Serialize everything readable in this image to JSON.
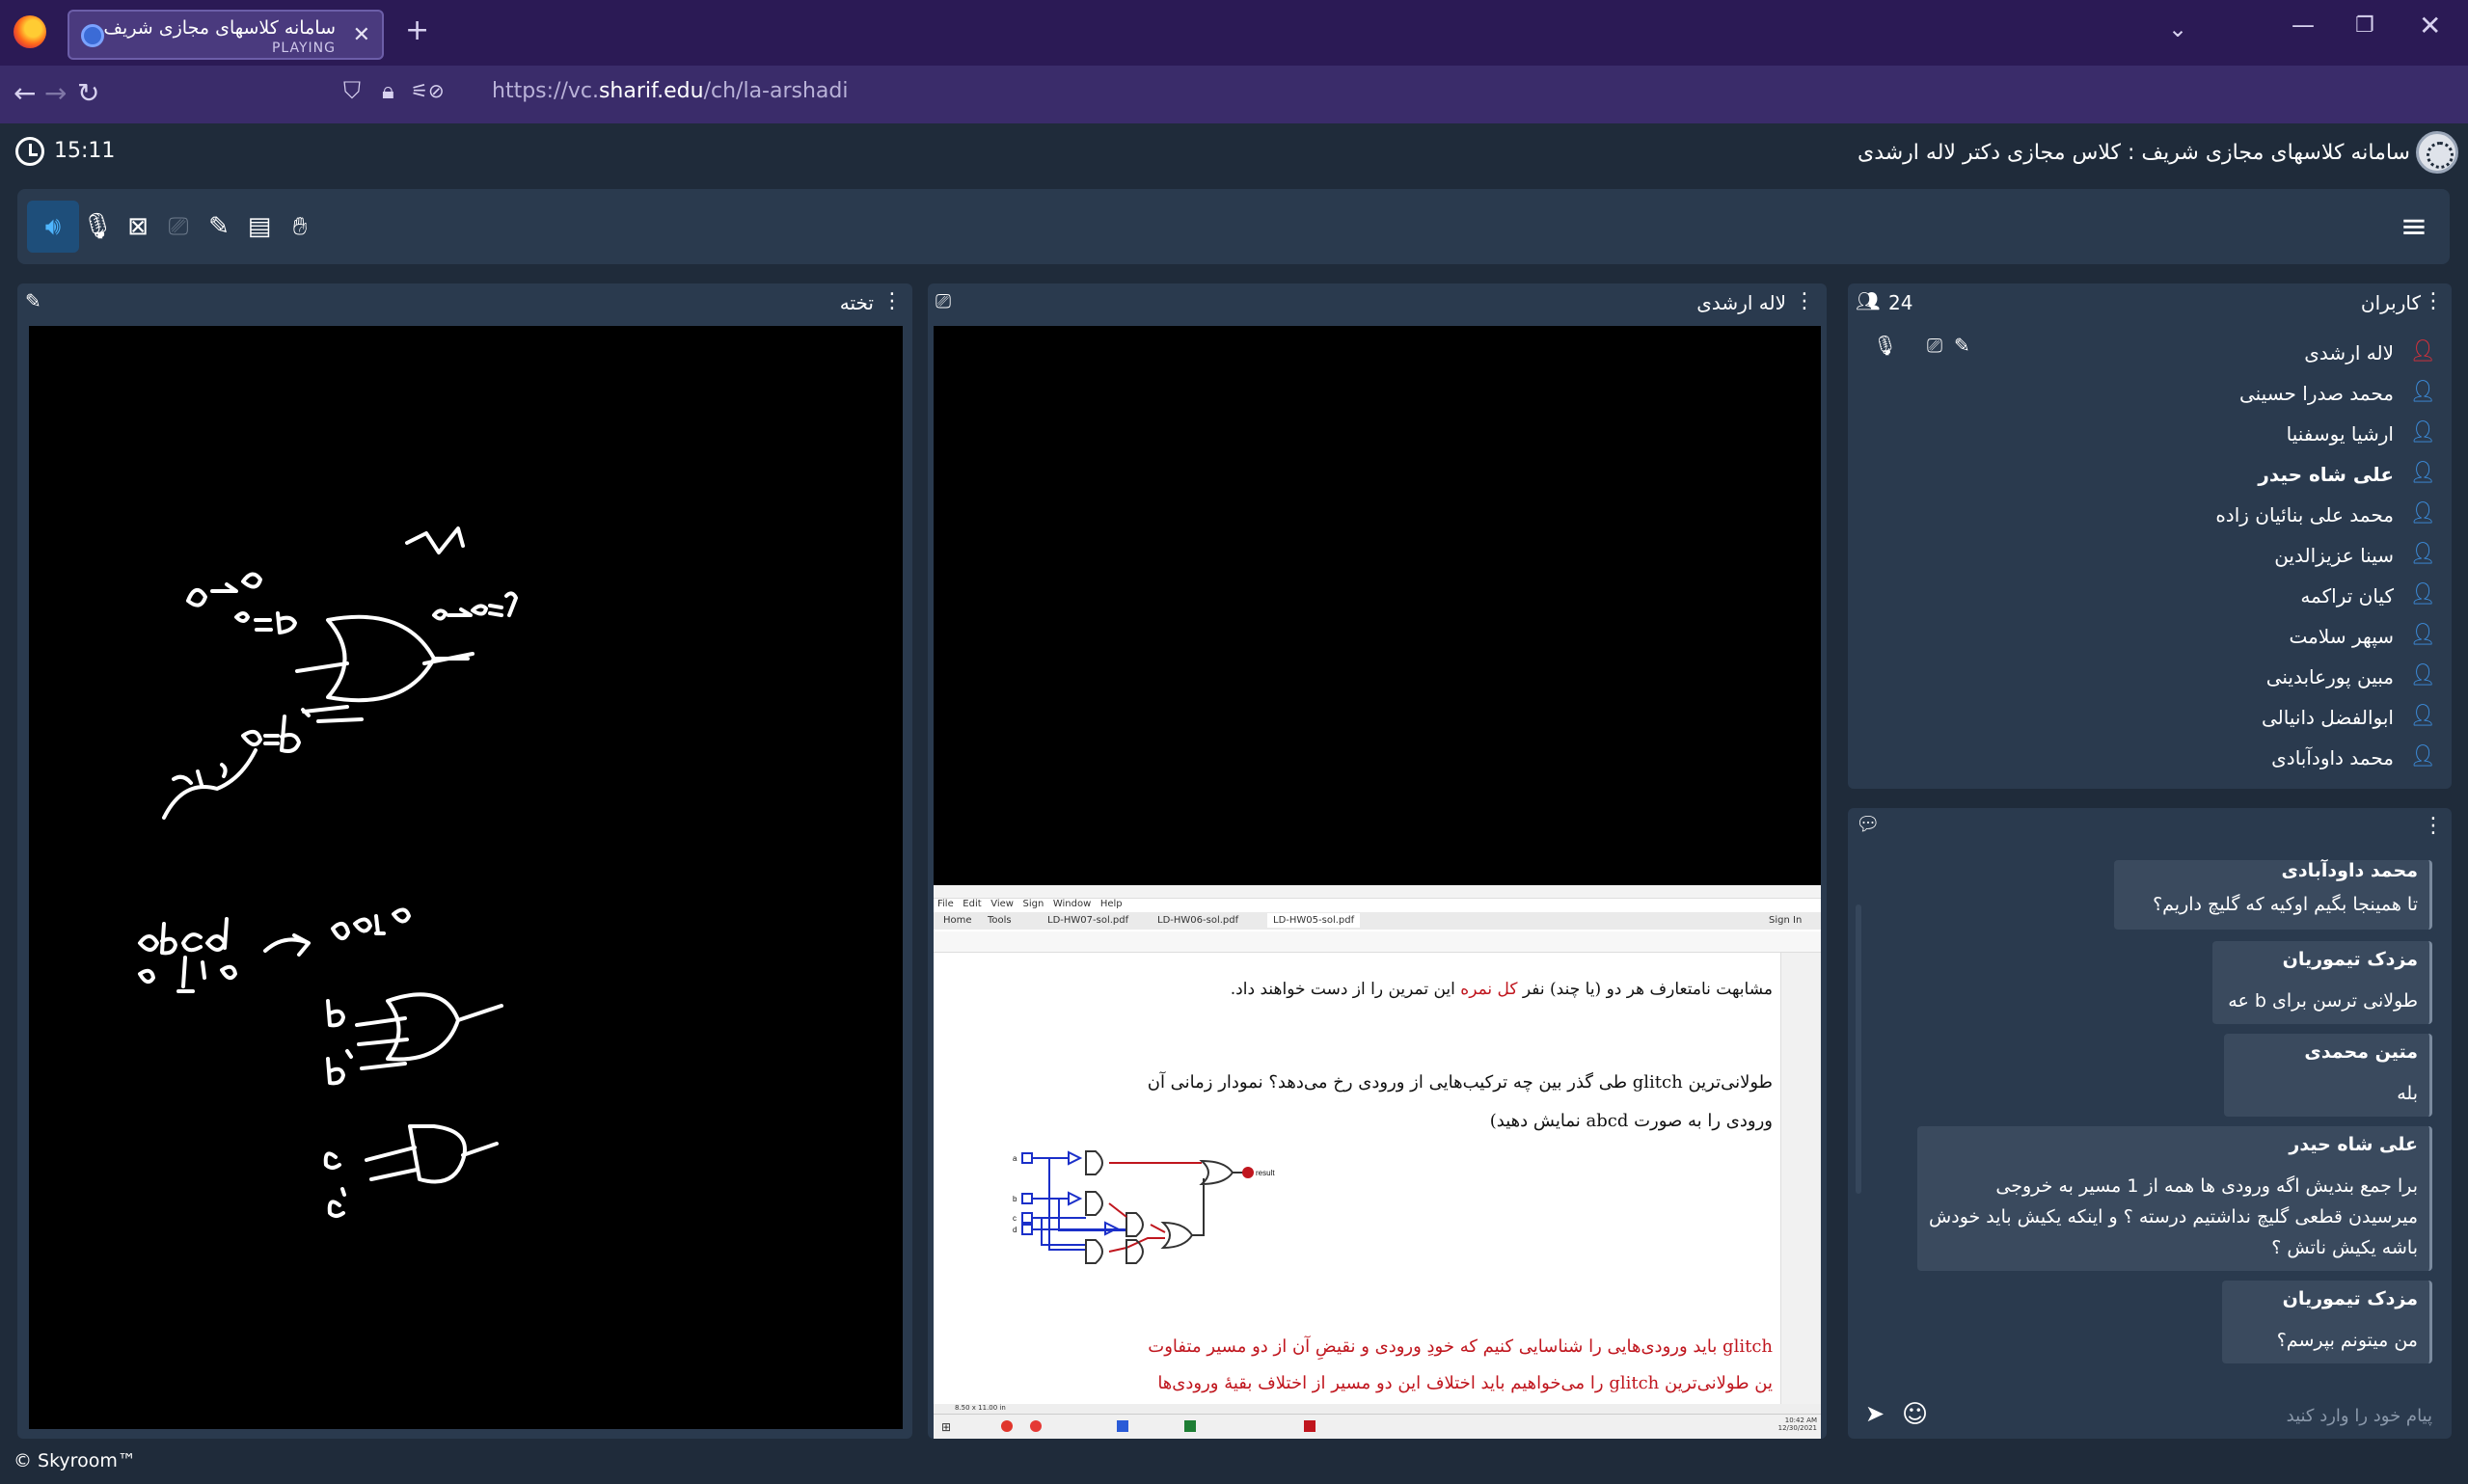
{
  "browser": {
    "tab_title": "سامانه کلاسهای مجازی شریف",
    "tab_status": "PLAYING",
    "url_prefix": "https://vc.",
    "url_domain": "sharif.edu",
    "url_path": "/ch/la-arshadi"
  },
  "app": {
    "time": "15:11",
    "title": "سامانه کلاسهای مجازی شریف : کلاس مجازی دکتر لاله ارشدی",
    "footer": "© Skyroom™"
  },
  "toolbar": {
    "buttons": [
      "speaker-icon",
      "mic-off-icon",
      "camera-off-icon",
      "share-screen-icon",
      "whiteboard-pen-icon",
      "files-icon",
      "raise-hand-icon",
      "menu-icon"
    ]
  },
  "whiteboard": {
    "title": "تخته",
    "handwriting": [
      "a→0",
      "a=b",
      "b→a→o",
      "0=b'",
      "abcd",
      "0 1 1 0",
      "0010",
      "b",
      "b'",
      "c",
      "c'",
      "طولانی تر"
    ]
  },
  "presenter": {
    "title": "لاله ارشدی",
    "shared_screen": {
      "menu": [
        "File",
        "Edit",
        "View",
        "Sign",
        "Window",
        "Help"
      ],
      "tabs": [
        "Home",
        "Tools",
        "LD-HW07-sol.pdf",
        "LD-HW06-sol.pdf",
        "LD-HW05-sol.pdf"
      ],
      "sign_in": "Sign In",
      "line1": "مشابهت نامتعارف هر دو (یا چند) نفر",
      "line1_red": "کل نمره",
      "line1_end": "این تمرین را از دست خواهند داد.",
      "question1": "طولانی‌ترین glitch طی گذر بین چه ترکیب‌هایی از ورودی رخ می‌دهد؟ نمودار زمانی آن",
      "question2": "ورودی را به صورت abcd نمایش دهید)",
      "answer1": "glitch باید ورودی‌هایی را شناسایی کنیم که خودِ ورودی و نقیضِ آن از دو مسیر متفاوت",
      "answer2": "ین طولانی‌ترین glitch را می‌خواهیم باید اختلاف این دو مسیر از اختلاف بقیهٔ ورودی‌ها",
      "circuit_inputs": [
        "a",
        "b",
        "c",
        "d"
      ],
      "circuit_output": "result",
      "taskbar_time": "10:42 AM",
      "taskbar_date": "12/30/2021",
      "page_size": "8.50 x 11.00 in"
    }
  },
  "users": {
    "title": "کاربران",
    "count": "24",
    "list": [
      {
        "name": "لاله ارشدی",
        "role": "host",
        "bold": false
      },
      {
        "name": "محمد صدرا حسینی",
        "role": "user",
        "bold": false
      },
      {
        "name": "ارشیا یوسفنیا",
        "role": "user",
        "bold": false
      },
      {
        "name": "علی شاه حیدر",
        "role": "user",
        "bold": true
      },
      {
        "name": "محمد علی بنائیان زاده",
        "role": "user",
        "bold": false
      },
      {
        "name": "سینا عزیزالدین",
        "role": "user",
        "bold": false
      },
      {
        "name": "کیان تراکمه",
        "role": "user",
        "bold": false
      },
      {
        "name": "سپهر سلامت",
        "role": "user",
        "bold": false
      },
      {
        "name": "مبین پورعابدینی",
        "role": "user",
        "bold": false
      },
      {
        "name": "ابوالفضل دانیالی",
        "role": "user",
        "bold": false
      },
      {
        "name": "محمد داودآبادی",
        "role": "user",
        "bold": false
      }
    ],
    "colors": {
      "host": "#e0303a",
      "user": "#3d8fe0"
    }
  },
  "chat": {
    "messages": [
      {
        "author": "محمد داودآبادی",
        "text": "تا همینجا بگیم اوکیه که گلیچ داریم؟"
      },
      {
        "author": "مزدک تیموریان",
        "text": "طولانی ترسن برای b عه"
      },
      {
        "author": "متین محمدی",
        "text": "بله"
      },
      {
        "author": "علی شاه حیدر",
        "text": "برا جمع بندیش اگه ورودی ها همه از 1 مسیر به خروجی میرسیدن قطعی گلیچ نداشتیم درسته ؟ و اینکه یکیش باید خودش باشه یکیش ناتش ؟"
      },
      {
        "author": "مزدک تیموریان",
        "text": "من میتونم بپرسم؟"
      }
    ],
    "input_placeholder": "پیام خود را وارد کنید"
  },
  "colors": {
    "page_bg": "#1f2b3a",
    "panel_bg": "#2a3a4e",
    "browser_tabbar": "#2b1a55",
    "browser_navbar": "#3a2c6a",
    "active_button": "#4fb6ff"
  }
}
